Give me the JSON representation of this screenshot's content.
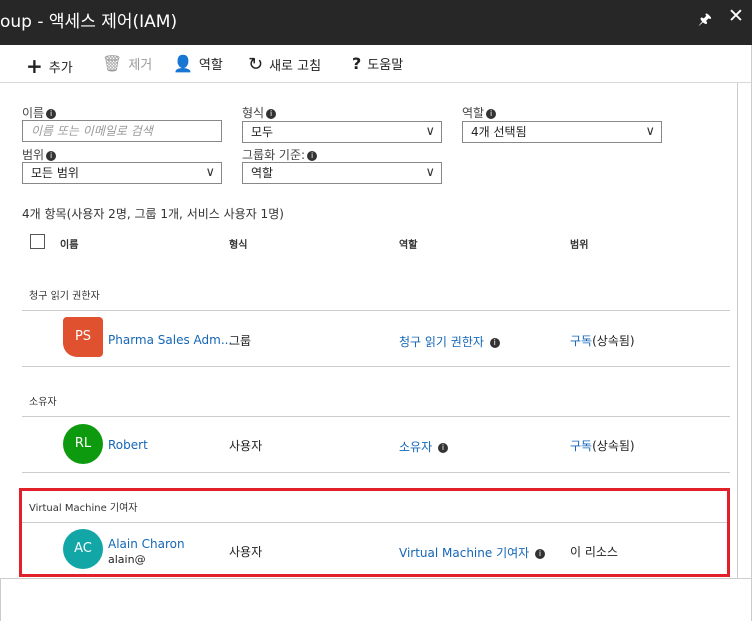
{
  "header": {
    "title": "oup - 액세스 제어(IAM)",
    "pin_icon": "pin-icon",
    "close_icon": "close-icon"
  },
  "toolbar": {
    "add": "추가",
    "remove": "제거",
    "roles": "역할",
    "refresh": "새로 고침",
    "help": "도움말"
  },
  "filters": {
    "name_label": "이름",
    "name_placeholder": "이름 또는 이메일로 검색",
    "type_label": "형식",
    "type_value": "모두",
    "role_label": "역할",
    "role_value": "4개 선택됨",
    "scope_label": "범위",
    "scope_value": "모든 범위",
    "groupby_label": "그룹화 기준:",
    "groupby_value": "역할"
  },
  "summary": "4개 항목(사용자 2명, 그룹 1개, 서비스 사용자 1명)",
  "columns": {
    "name": "이름",
    "type": "형식",
    "role": "역할",
    "scope": "범위"
  },
  "groups": [
    {
      "title": "청구 읽기 권한자",
      "rows": [
        {
          "initials": "PS",
          "name": "Pharma Sales Adm...",
          "email": "",
          "type": "그룹",
          "role": "청구 읽기 권한자",
          "scope_link": "구독",
          "scope_suffix": "(상속됨)",
          "color": "#e0512f"
        }
      ]
    },
    {
      "title": "소유자",
      "rows": [
        {
          "initials": "RL",
          "name": "Robert",
          "email": "",
          "type": "사용자",
          "role": "소유자",
          "scope_link": "구독",
          "scope_suffix": "(상속됨)",
          "color": "#0e9a0e"
        }
      ]
    },
    {
      "title": "Virtual Machine 기여자",
      "rows": [
        {
          "initials": "AC",
          "name": "Alain Charon",
          "email": "alain@",
          "type": "사용자",
          "role": "Virtual Machine 기여자",
          "scope_link": "",
          "scope_suffix": "이 리소스",
          "color": "#13a6a6"
        }
      ]
    }
  ],
  "accent_color": "#1566b8",
  "highlight_color": "#e2202a"
}
